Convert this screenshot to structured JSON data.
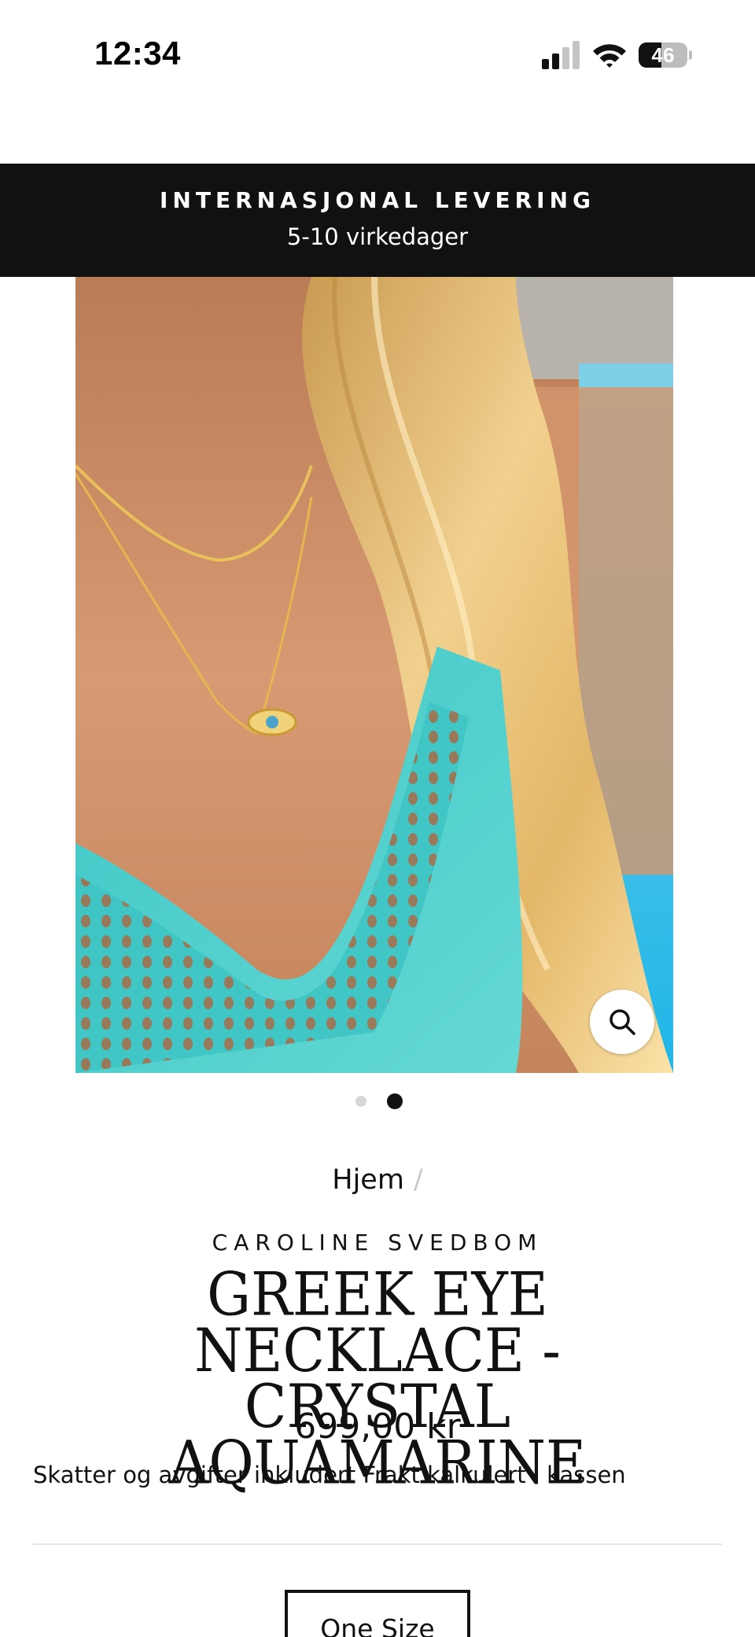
{
  "status_bar": {
    "time": "12:34",
    "battery_level": "46",
    "battery_fraction": 0.46,
    "signal_bars_active": 2,
    "signal_bars_total": 4
  },
  "announcement": {
    "title": "INTERNASJONAL LEVERING",
    "subtitle": "5-10 virkedager"
  },
  "gallery": {
    "image_description_icon": "product-photo",
    "current_slide": 2,
    "total_slides": 2,
    "zoom_icon": "search-icon"
  },
  "breadcrumb": {
    "home_label": "Hjem",
    "separator": "/"
  },
  "product": {
    "vendor": "CAROLINE SVEDBOM",
    "title_line1": "GREEK EYE NECKLACE -",
    "title_line2": "CRYSTAL AQUAMARINE",
    "price": "699,00 kr",
    "tax_note": "Skatter og avgifter inkludert Frakt kalkulert i kassen",
    "size_option": "One Size"
  },
  "colors": {
    "banner_bg": "#111111",
    "text": "#111111",
    "dot_inactive": "#d6d6d6",
    "dot_active": "#111111"
  }
}
